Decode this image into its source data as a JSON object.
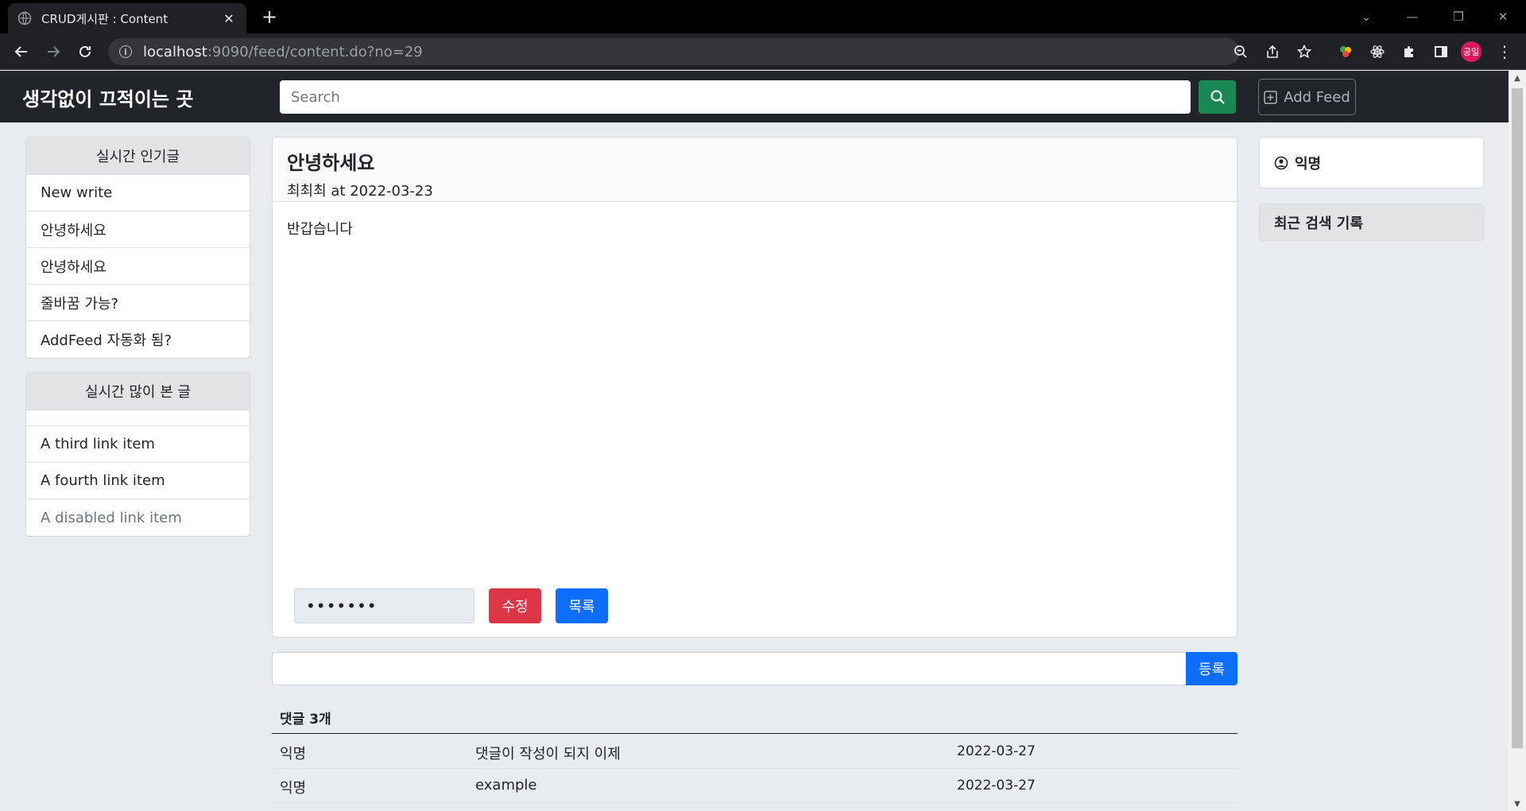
{
  "browser": {
    "tab_title": "CRUD게시판 : Content",
    "url_host": "localhost",
    "url_path": ":9090/feed/content.do?no=29",
    "profile_label": "공일"
  },
  "navbar": {
    "brand": "생각없이 끄적이는 곳",
    "search_placeholder": "Search",
    "add_feed_label": "Add Feed"
  },
  "sidebar": {
    "popular_title": "실시간 인기글",
    "popular_items": [
      "New write",
      "안녕하세요",
      "안녕하세요",
      "줄바꿈 가능?",
      "AddFeed 자동화 됨?"
    ],
    "most_viewed_title": "실시간 많이 본 글",
    "most_viewed_items": [
      "A third link item",
      "A fourth link item",
      "A disabled link item"
    ]
  },
  "post": {
    "title": "안녕하세요",
    "meta": "최최최 at 2022-03-23",
    "body": "반갑습니다",
    "password_mask": "•••••••",
    "edit_label": "수정",
    "list_label": "목록"
  },
  "comment_form": {
    "submit_label": "등록"
  },
  "comments": {
    "heading": "댓글 3개",
    "rows": [
      {
        "author": "익명",
        "text": "댓글이 작성이 되지 이제",
        "date": "2022-03-27"
      },
      {
        "author": "익명",
        "text": "example",
        "date": "2022-03-27"
      }
    ]
  },
  "right_sidebar": {
    "user_name": "익명",
    "recent_search_title": "최근 검색 기록"
  },
  "colors": {
    "navbar_bg": "#212529",
    "search_btn": "#198754",
    "edit_btn": "#dc3545",
    "primary_btn": "#0d6efd"
  }
}
